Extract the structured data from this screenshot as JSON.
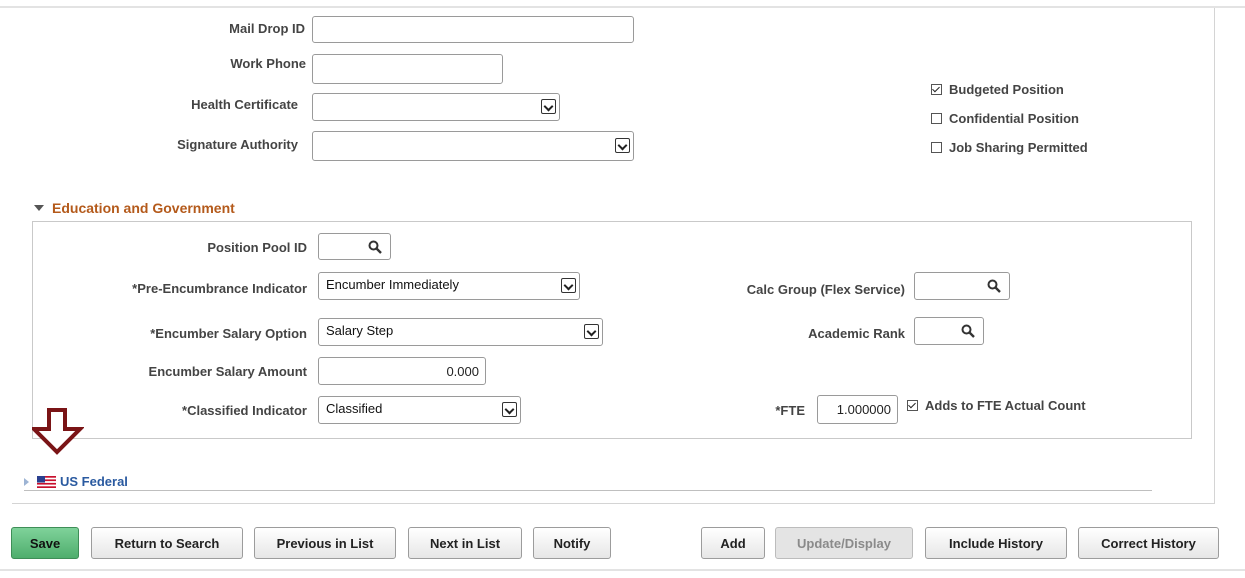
{
  "fields": {
    "mail_drop_id": {
      "label": "Mail Drop ID",
      "value": ""
    },
    "work_phone": {
      "label": "Work Phone",
      "value": ""
    },
    "health_certificate": {
      "label": "Health Certificate",
      "value": ""
    },
    "signature_authority": {
      "label": "Signature Authority",
      "value": ""
    }
  },
  "checkboxes": [
    {
      "label": "Budgeted Position",
      "checked": true
    },
    {
      "label": "Confidential Position",
      "checked": false
    },
    {
      "label": "Job Sharing Permitted",
      "checked": false
    }
  ],
  "education": {
    "title": "Education and Government",
    "position_pool_id": {
      "label": "Position Pool ID",
      "value": ""
    },
    "pre_encumbrance": {
      "label": "*Pre-Encumbrance Indicator",
      "value": "Encumber Immediately"
    },
    "encumber_salary_option": {
      "label": "*Encumber Salary Option",
      "value": "Salary Step"
    },
    "encumber_salary_amount": {
      "label": "Encumber Salary Amount",
      "value": "0.000"
    },
    "classified_indicator": {
      "label": "*Classified Indicator",
      "value": "Classified"
    },
    "calc_group": {
      "label": "Calc Group (Flex Service)",
      "value": ""
    },
    "academic_rank": {
      "label": "Academic Rank",
      "value": ""
    },
    "fte": {
      "label": "*FTE",
      "value": "1.000000"
    },
    "adds_to_fte": {
      "label": "Adds to FTE Actual Count",
      "checked": true
    }
  },
  "us_federal": {
    "title": "US Federal"
  },
  "buttons": {
    "save": "Save",
    "return_to_search": "Return to Search",
    "previous_in_list": "Previous in List",
    "next_in_list": "Next in List",
    "notify": "Notify",
    "add": "Add",
    "update_display": "Update/Display",
    "include_history": "Include History",
    "correct_history": "Correct History"
  },
  "colors": {
    "section_title": "#b45a1b",
    "link_blue": "#2a5aa0",
    "arrow": "#7a1416",
    "save_green": "#5cb97a"
  },
  "icons": {
    "lookup": "magnifier-icon",
    "dropdown": "chevron-down-icon",
    "annotation": "down-arrow-icon",
    "flag": "us-flag-icon"
  }
}
